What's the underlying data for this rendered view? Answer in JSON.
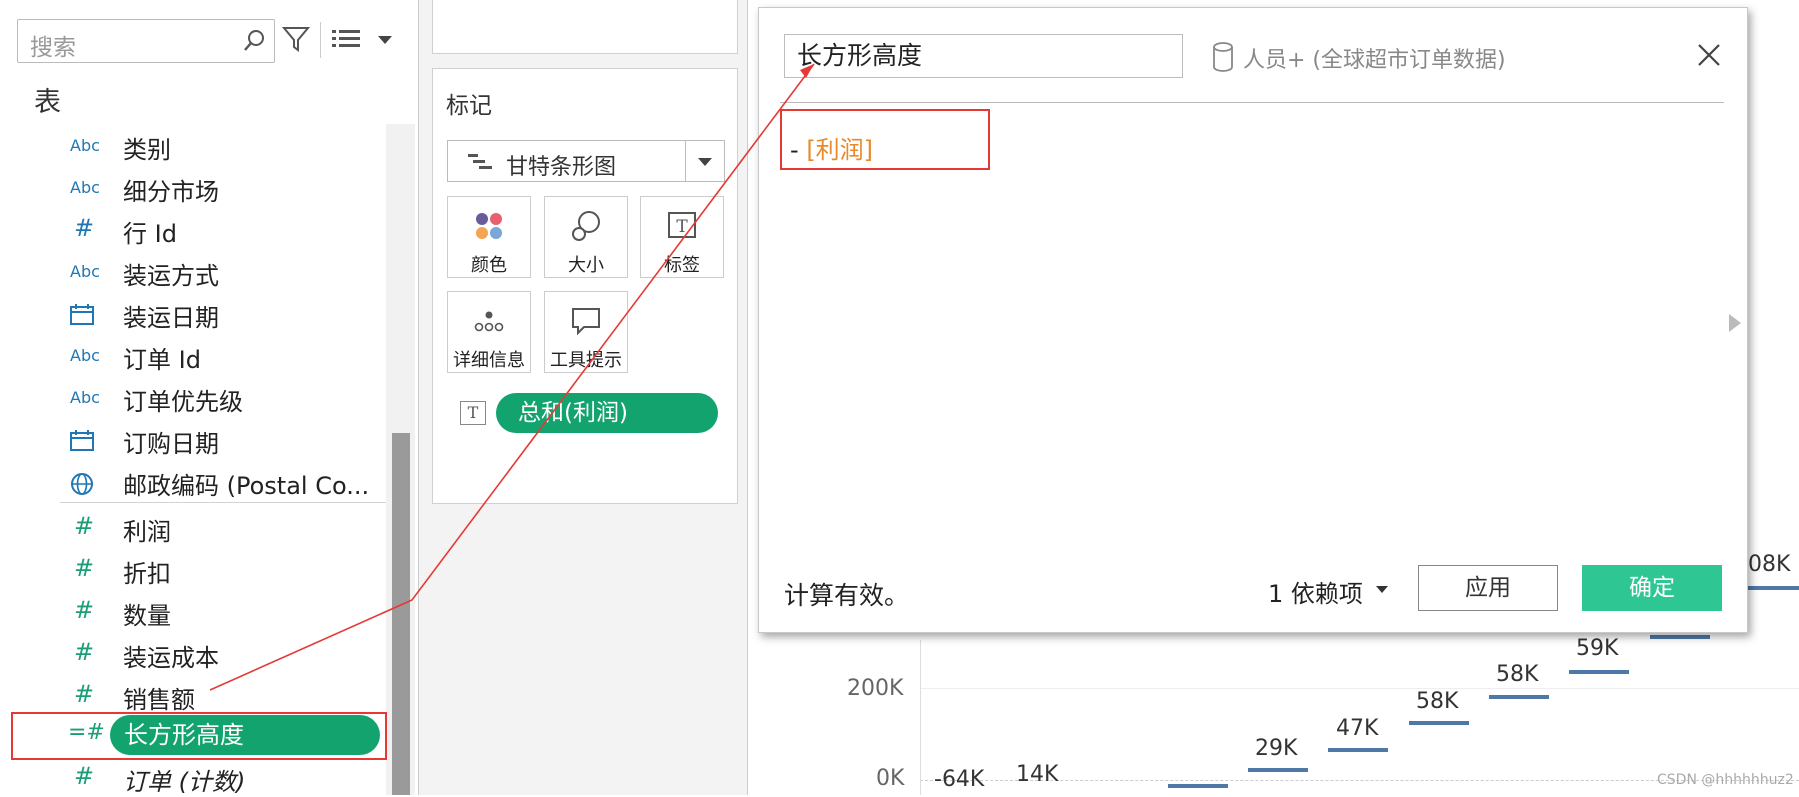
{
  "data_pane": {
    "search_placeholder": "搜索",
    "section_title": "表",
    "dimensions": [
      {
        "type": "Abc",
        "name": "类别"
      },
      {
        "type": "Abc",
        "name": "细分市场"
      },
      {
        "type": "#",
        "name": "行 Id"
      },
      {
        "type": "Abc",
        "name": "装运方式"
      },
      {
        "type": "date",
        "name": "装运日期"
      },
      {
        "type": "Abc",
        "name": "订单 Id"
      },
      {
        "type": "Abc",
        "name": "订单优先级"
      },
      {
        "type": "date",
        "name": "订购日期"
      },
      {
        "type": "geo",
        "name": "邮政编码 (Postal Co..."
      }
    ],
    "measures": [
      {
        "type": "#",
        "name": "利润"
      },
      {
        "type": "#",
        "name": "折扣"
      },
      {
        "type": "#",
        "name": "数量"
      },
      {
        "type": "#",
        "name": "装运成本"
      },
      {
        "type": "#",
        "name": "销售额"
      }
    ],
    "selected_field": {
      "type": "=#",
      "name": "长方形高度"
    },
    "last_field": {
      "type": "#",
      "name": "订单 (计数)"
    }
  },
  "marks_card": {
    "title": "标记",
    "mark_type": "甘特条形图",
    "buttons": [
      "颜色",
      "大小",
      "标签",
      "详细信息",
      "工具提示"
    ],
    "label_shelf_type": "T",
    "label_pill": "总和(利润)"
  },
  "calc_dialog": {
    "name": "长方形高度",
    "datasource": "人员+ (全球超市订单数据)",
    "formula_operator": "-",
    "formula_field": "[利润]",
    "status": "计算有效。",
    "dependencies": "1 依赖项",
    "apply_label": "应用",
    "ok_label": "确定"
  },
  "chart": {
    "axis_labels": [
      "200K",
      "0K"
    ],
    "data_labels": [
      "-64K",
      "14K",
      "29K",
      "47K",
      "58K",
      "58K",
      "59K",
      "08K"
    ]
  },
  "colors": {
    "pill_green": "#13a36e",
    "ok_green": "#2ec794",
    "formula_field_orange": "#e8892c",
    "annotation_red": "#e53935",
    "bar_blue": "#4e79a7"
  },
  "watermark": "CSDN @hhhhhhuz2"
}
